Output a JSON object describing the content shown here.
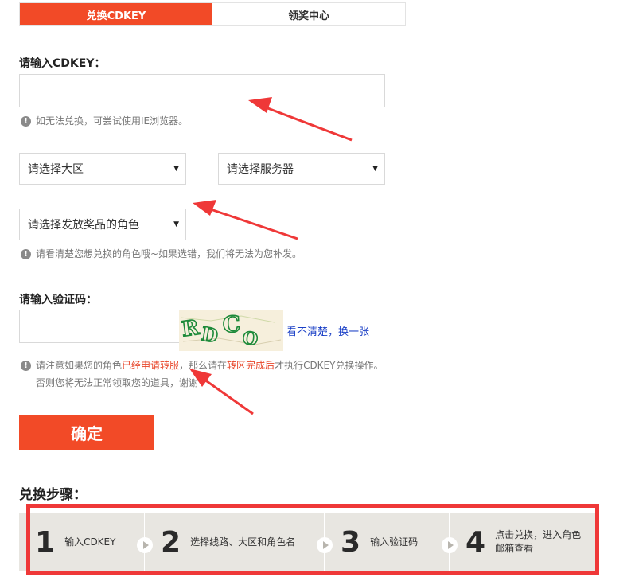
{
  "tabs": [
    {
      "label": "兑换CDKEY",
      "active": true
    },
    {
      "label": "领奖中心",
      "active": false
    }
  ],
  "cdkey": {
    "label": "请输入CDKEY：",
    "value": "",
    "tip": "如无法兑换，可尝试使用IE浏览器。"
  },
  "selects": {
    "region": "请选择大区",
    "server": "请选择服务器",
    "role": "请选择发放奖品的角色",
    "tip": "请看清楚您想兑换的角色哦~如果选错，我们将无法为您补发。"
  },
  "captcha": {
    "label": "请输入验证码：",
    "value": "",
    "image_text": "RDCO",
    "refresh": "看不清楚，换一张"
  },
  "notice": {
    "line1_a": "请注意如果您的角色",
    "line1_hl1": "已经申请转服",
    "line1_b": "，那么请在",
    "line1_hl2": "转区完成后",
    "line1_c": "才执行CDKEY兑换操作。",
    "line2": "否则您将无法正常领取您的道具，谢谢"
  },
  "confirm_label": "确定",
  "steps": {
    "title": "兑换步骤：",
    "items": [
      {
        "num": "1",
        "text": "输入CDKEY"
      },
      {
        "num": "2",
        "text": "选择线路、大区和角色名"
      },
      {
        "num": "3",
        "text": "输入验证码"
      },
      {
        "num": "4",
        "text_line1": "点击兑换，进入角色",
        "text_line2": "邮箱查看"
      }
    ]
  },
  "colors": {
    "accent": "#f24a27",
    "annotation": "#ef3838",
    "link": "#1a3fc6"
  },
  "icons": {
    "tip": "exclamation-circle-icon",
    "caret": "caret-down-icon",
    "step": "play-circle-icon"
  }
}
